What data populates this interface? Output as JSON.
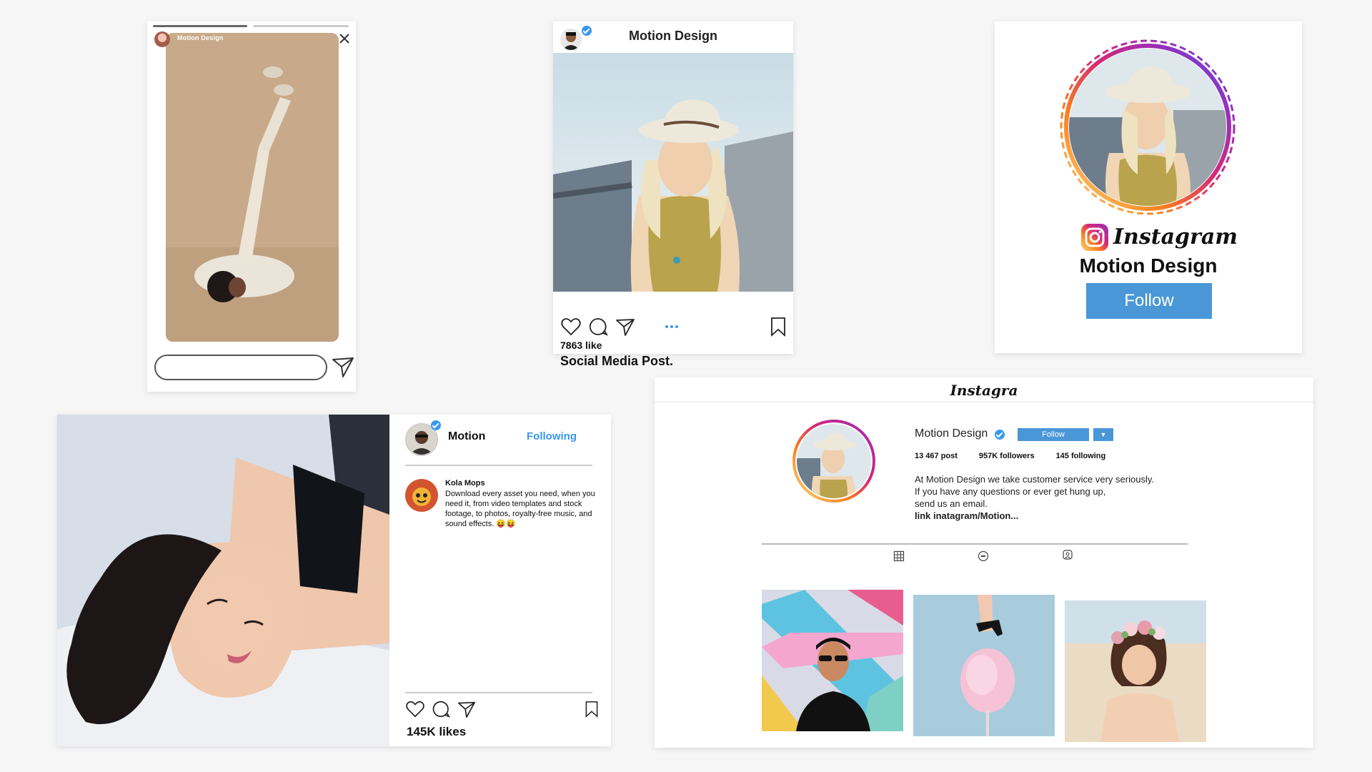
{
  "story": {
    "username": "Motion Design"
  },
  "post": {
    "username": "Motion Design",
    "likes": "7863 like",
    "caption": "Social Media Post."
  },
  "badge": {
    "brand": "Instagram",
    "name": "Motion Design",
    "follow_label": "Follow"
  },
  "landscape_post": {
    "username": "Motion",
    "following_label": "Following",
    "comment": {
      "author": "Kola Mops",
      "text": "Download every asset you need, when you need it, from video templates and stock footage, to photos, royalty-free music, and sound effects. 😝😝"
    },
    "likes": "145K likes"
  },
  "profile": {
    "logo": "Instagra",
    "name": "Motion Design",
    "follow_label": "Follow",
    "stats": {
      "posts": "13 467 post",
      "followers": "957K followers",
      "following": "145 following"
    },
    "bio": {
      "line1": "At Motion Design we take customer service very seriously.",
      "line2": "If you have any questions or ever get hung up,",
      "line3": "send us an email.",
      "link": "link inatagram/Motion..."
    },
    "tabs": [
      "grid-icon",
      "tv-icon",
      "tagged-icon"
    ]
  },
  "colors": {
    "accent": "#3897f0",
    "button": "#4a97d8",
    "background": "#f6f6f6"
  }
}
